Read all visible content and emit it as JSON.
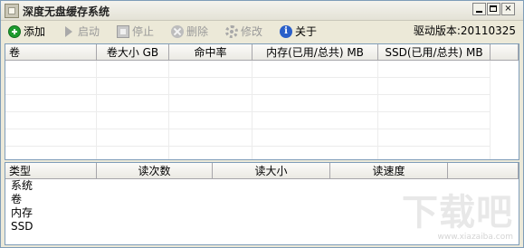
{
  "window": {
    "title": "深度无盘缓存系统",
    "controls": {
      "min": "minimize",
      "max": "maximize",
      "close": "×"
    }
  },
  "toolbar": {
    "items": [
      {
        "label": "添加",
        "icon": "add-icon",
        "enabled": true
      },
      {
        "label": "启动",
        "icon": "play-icon",
        "enabled": false
      },
      {
        "label": "停止",
        "icon": "stop-icon",
        "enabled": false
      },
      {
        "label": "删除",
        "icon": "delete-icon",
        "enabled": false
      },
      {
        "label": "修改",
        "icon": "gear-icon",
        "enabled": false
      },
      {
        "label": "关于",
        "icon": "info-icon",
        "enabled": true
      }
    ],
    "driver_version": "驱动版本:20110325"
  },
  "volumes_table": {
    "columns": [
      "卷",
      "卷大小 GB",
      "命中率",
      "内存(已用/总共) MB",
      "SSD(已用/总共) MB"
    ],
    "rows": []
  },
  "stats_table": {
    "columns": [
      "类型",
      "读次数",
      "读大小",
      "读速度"
    ],
    "rows": [
      {
        "type": "系统",
        "reads": "",
        "read_size": "",
        "read_speed": ""
      },
      {
        "type": "卷",
        "reads": "",
        "read_size": "",
        "read_speed": ""
      },
      {
        "type": "内存",
        "reads": "",
        "read_size": "",
        "read_speed": ""
      },
      {
        "type": "SSD",
        "reads": "",
        "read_size": "",
        "read_speed": ""
      }
    ]
  },
  "watermark": {
    "logo": "下载吧",
    "url": "www.xiazaiba.com"
  },
  "colors": {
    "window_bg": "#ece9d8",
    "border": "#7f9db9",
    "add_icon": "#1e9b2e",
    "info_icon": "#2a5fc9",
    "disabled_text": "#9a9a9a"
  }
}
